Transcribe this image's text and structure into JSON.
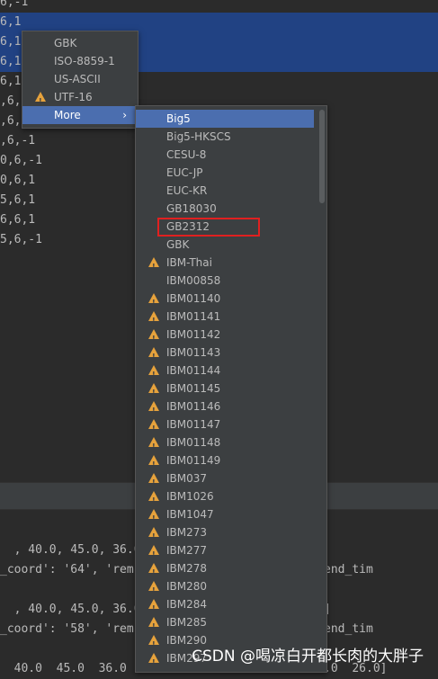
{
  "editor": {
    "lines": [
      {
        "text": "6,-1",
        "selected": false
      },
      {
        "text": "6,1",
        "selected": true
      },
      {
        "text": "6,1",
        "selected": true
      },
      {
        "text": "6,1",
        "selected": true
      },
      {
        "text": "6,1",
        "selected": false
      },
      {
        "text": ",6,1",
        "selected": false
      },
      {
        "text": ",6,1",
        "selected": false
      },
      {
        "text": ",6,-1",
        "selected": false
      },
      {
        "text": "0,6,-1",
        "selected": false
      },
      {
        "text": "0,6,1",
        "selected": false
      },
      {
        "text": "5,6,1",
        "selected": false
      },
      {
        "text": "6,6,1",
        "selected": false
      },
      {
        "text": "5,6,-1",
        "selected": false
      }
    ]
  },
  "console": {
    "lines": [
      "  , 40.0, 45.0, 36.0,",
      "_coord': '64', 'rem                    '54', 'end_tim",
      "",
      "  , 40.0, 45.0, 36.0,                      1.0]",
      "_coord': '58', 'rem                    '46', 'end_tim",
      "",
      "  40.0  45.0  36.0  35.0  25.0  22.0  20.0  21.0  26.0]"
    ]
  },
  "encoding_menu": {
    "items": [
      {
        "label": "GBK",
        "warning": false
      },
      {
        "label": "ISO-8859-1",
        "warning": false
      },
      {
        "label": "US-ASCII",
        "warning": false
      },
      {
        "label": "UTF-16",
        "warning": true
      },
      {
        "label": "More",
        "warning": false,
        "submenu": true
      }
    ],
    "submenu_chevron": "›"
  },
  "more_submenu": {
    "items": [
      {
        "label": "Big5",
        "warning": false
      },
      {
        "label": "Big5-HKSCS",
        "warning": false
      },
      {
        "label": "CESU-8",
        "warning": false
      },
      {
        "label": "EUC-JP",
        "warning": false
      },
      {
        "label": "EUC-KR",
        "warning": false
      },
      {
        "label": "GB18030",
        "warning": false
      },
      {
        "label": "GB2312",
        "warning": false
      },
      {
        "label": "GBK",
        "warning": false
      },
      {
        "label": "IBM-Thai",
        "warning": true
      },
      {
        "label": "IBM00858",
        "warning": false
      },
      {
        "label": "IBM01140",
        "warning": true
      },
      {
        "label": "IBM01141",
        "warning": true
      },
      {
        "label": "IBM01142",
        "warning": true
      },
      {
        "label": "IBM01143",
        "warning": true
      },
      {
        "label": "IBM01144",
        "warning": true
      },
      {
        "label": "IBM01145",
        "warning": true
      },
      {
        "label": "IBM01146",
        "warning": true
      },
      {
        "label": "IBM01147",
        "warning": true
      },
      {
        "label": "IBM01148",
        "warning": true
      },
      {
        "label": "IBM01149",
        "warning": true
      },
      {
        "label": "IBM037",
        "warning": true
      },
      {
        "label": "IBM1026",
        "warning": true
      },
      {
        "label": "IBM1047",
        "warning": true
      },
      {
        "label": "IBM273",
        "warning": true
      },
      {
        "label": "IBM277",
        "warning": true
      },
      {
        "label": "IBM278",
        "warning": true
      },
      {
        "label": "IBM280",
        "warning": true
      },
      {
        "label": "IBM284",
        "warning": true
      },
      {
        "label": "IBM285",
        "warning": true
      },
      {
        "label": "IBM290",
        "warning": true
      },
      {
        "label": "IBM297",
        "warning": true
      }
    ]
  },
  "watermark": "CSDN @喝凉白开都长肉的大胖子",
  "colors": {
    "selection": "#214283",
    "menu_highlight": "#4b6eaf",
    "warning": "#e6a23c",
    "annotation_box": "#e02020"
  }
}
